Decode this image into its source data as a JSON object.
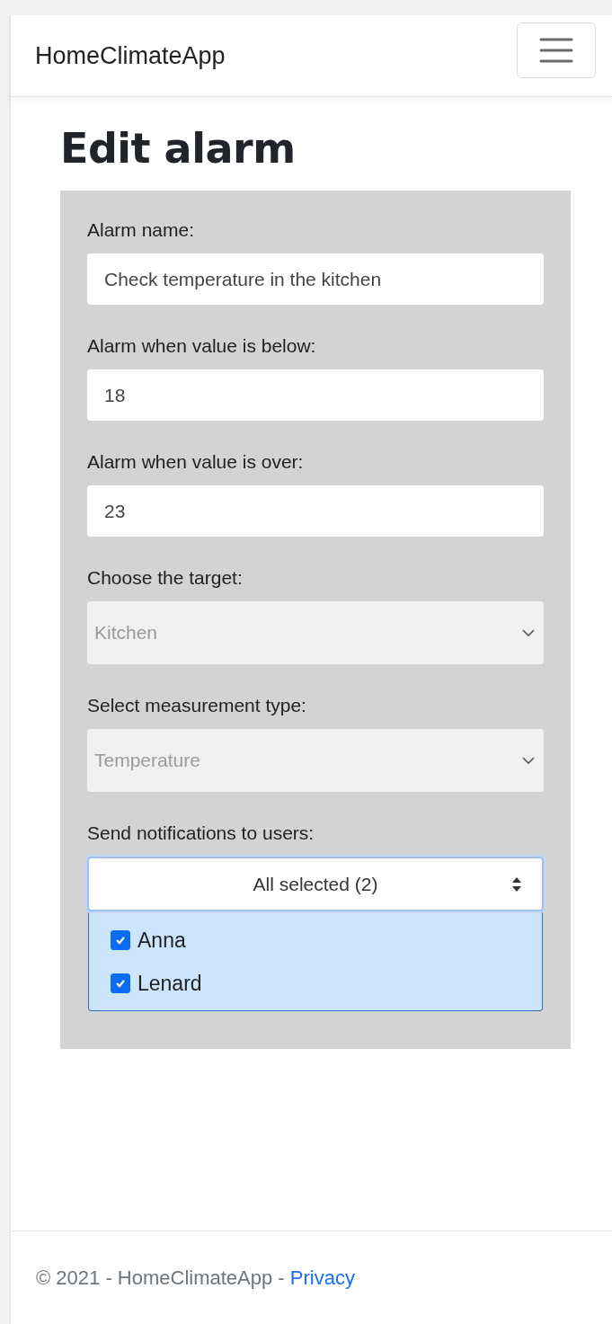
{
  "navbar": {
    "brand": "HomeClimateApp"
  },
  "heading": "Edit alarm",
  "fields": [
    {
      "kind": "input",
      "label": "Alarm name:",
      "value": "Check temperature in the kitchen"
    },
    {
      "kind": "input",
      "label": "Alarm when value is below:",
      "value": "18"
    },
    {
      "kind": "input",
      "label": "Alarm when value is over:",
      "value": "23"
    },
    {
      "kind": "select",
      "label": "Choose the target:",
      "value": "Kitchen",
      "disabled": true
    },
    {
      "kind": "select",
      "label": "Select measurement type:",
      "value": "Temperature",
      "disabled": true
    },
    {
      "kind": "multiselect",
      "label": "Send notifications to users:",
      "summary": "All selected (2)",
      "options": [
        {
          "label": "Anna",
          "checked": true
        },
        {
          "label": "Lenard",
          "checked": true
        }
      ]
    }
  ],
  "footer": {
    "text": "© 2021 - HomeClimateApp - ",
    "link": "Privacy"
  }
}
